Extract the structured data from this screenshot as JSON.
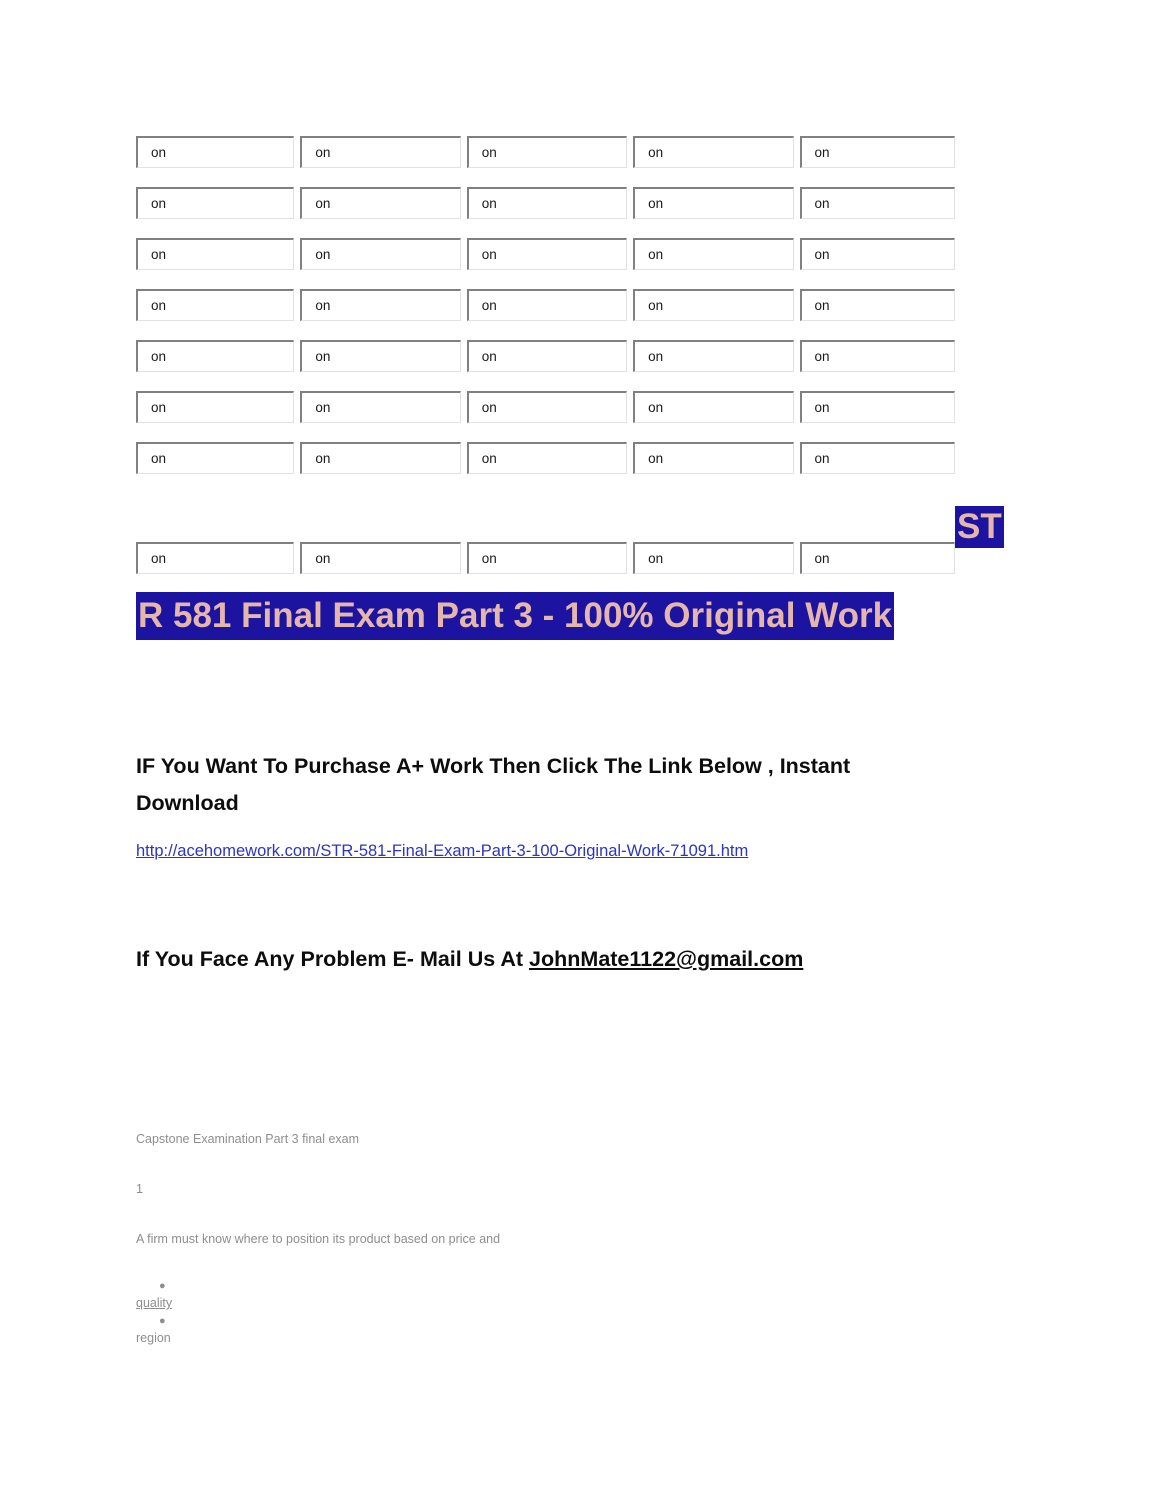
{
  "document": {
    "field_table": {
      "cell_value": "on",
      "columns": 5,
      "rows": 8,
      "gap_after_row_index": 6
    },
    "title_fragment": {
      "text": "ST",
      "background_color": "#1c14a0",
      "text_color": "#e5b6ac"
    },
    "title": {
      "text": "R 581 Final Exam Part 3 - 100% Original Work",
      "background_color": "#1c14a0",
      "text_color": "#e5b6ac"
    },
    "promo": {
      "heading": "IF You Want To Purchase A+ Work Then Click The Link Below  , Instant Download",
      "link_text": "http://acehomework.com/STR-581-Final-Exam-Part-3-100-Original-Work-71091.htm",
      "link_color": "#2b35c4"
    },
    "support": {
      "prefix": "If You Face Any Problem E- Mail Us At  ",
      "email": "JohnMate1122@gmail.com"
    },
    "scanned_content": {
      "exam_label": "Capstone Examination Part 3 final exam",
      "question_number": "1",
      "question_text": "A firm must know where to position its product based on price and",
      "bullet_glyph": "●",
      "options": [
        {
          "label": "quality",
          "underlined": true
        },
        {
          "label": "region",
          "underlined": false
        }
      ]
    }
  }
}
